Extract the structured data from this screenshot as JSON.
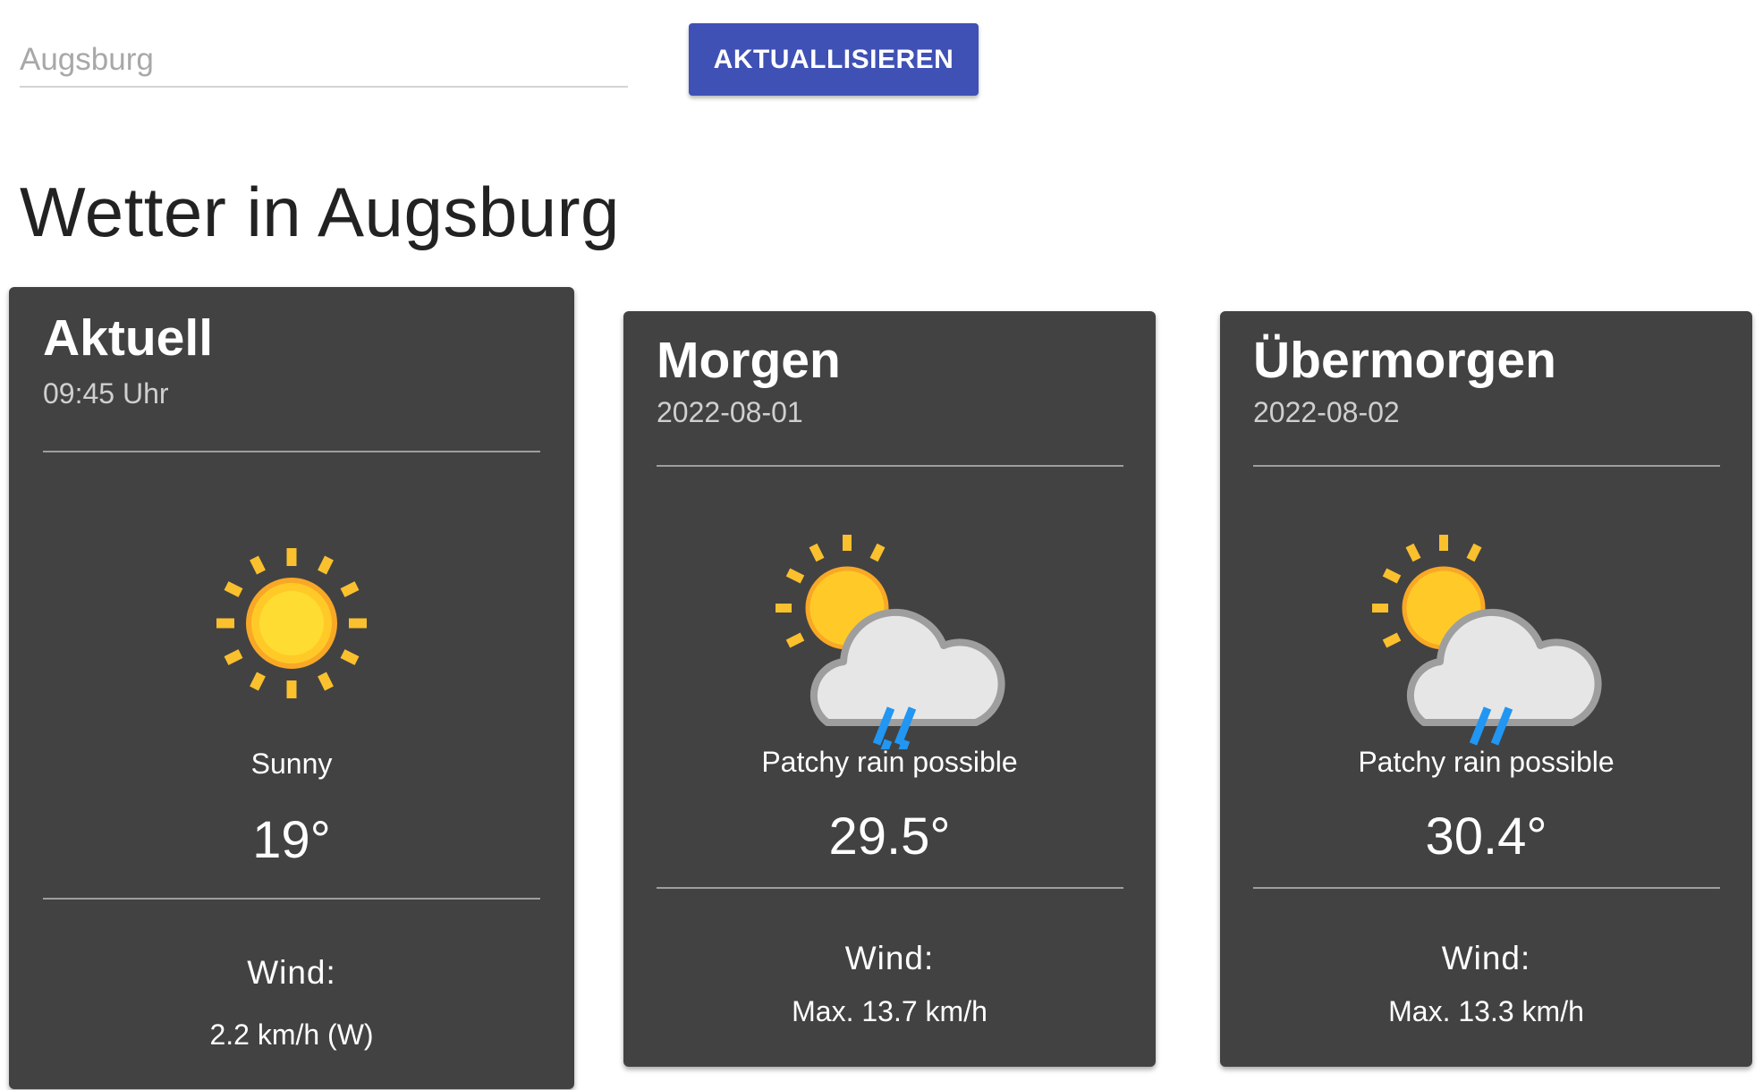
{
  "search": {
    "value": "",
    "placeholder": "Augsburg"
  },
  "refresh_label": "AKTUALLISIEREN",
  "page_title": "Wetter in Augsburg",
  "cards": [
    {
      "title": "Aktuell",
      "subtitle": "09:45 Uhr",
      "icon": "sun-icon",
      "condition": "Sunny",
      "temperature": "19°",
      "wind_label": "Wind:",
      "wind_value": "2.2 km/h (W)"
    },
    {
      "title": "Morgen",
      "subtitle": "2022-08-01",
      "icon": "patchy-rain-icon",
      "condition": "Patchy rain possible",
      "temperature": "29.5°",
      "wind_label": "Wind:",
      "wind_value": "Max. 13.7 km/h"
    },
    {
      "title": "Übermorgen",
      "subtitle": "2022-08-02",
      "icon": "patchy-rain-icon",
      "condition": "Patchy rain possible",
      "temperature": "30.4°",
      "wind_label": "Wind:",
      "wind_value": "Max. 13.3 km/h"
    }
  ],
  "colors": {
    "button": "#3f51b5",
    "card": "#424242",
    "sun": "#fbc02d",
    "rain": "#2196f3"
  }
}
